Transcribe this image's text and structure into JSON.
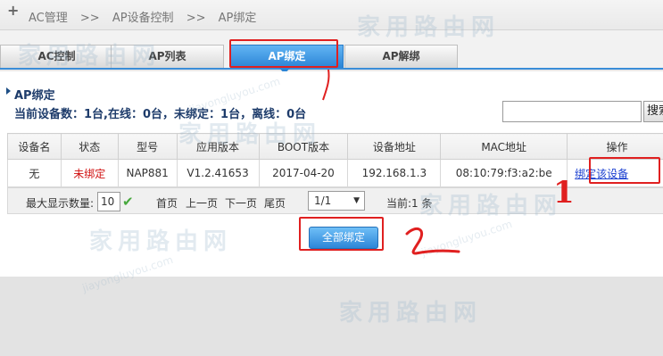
{
  "breadcrumb": {
    "items": [
      "AC管理",
      ">>",
      "AP设备控制",
      ">>",
      "AP绑定"
    ]
  },
  "tabs": [
    {
      "label": "AC控制"
    },
    {
      "label": "AP列表"
    },
    {
      "label": "AP绑定"
    },
    {
      "label": "AP解绑"
    }
  ],
  "active_tab": "AP绑定",
  "section": {
    "title": "AP绑定",
    "summary": "当前设备数：1台,在线：0台，未绑定：1台，离线：0台"
  },
  "search": {
    "value": "",
    "button_label": "搜索"
  },
  "table": {
    "headers": [
      "设备名",
      "状态",
      "型号",
      "应用版本",
      "BOOT版本",
      "设备地址",
      "MAC地址",
      "操作"
    ],
    "rows": [
      {
        "name": "无",
        "status": "未绑定",
        "model": "NAP881",
        "app_version": "V1.2.41653",
        "boot_version": "2017-04-20",
        "ip": "192.168.1.3",
        "mac": "08:10:79:f3:a2:be",
        "action": "绑定该设备"
      }
    ]
  },
  "pager": {
    "max_display_label": "最大显示数量:",
    "max_display_value": "10",
    "first": "首页",
    "prev": "上一页",
    "next": "下一页",
    "last": "尾页",
    "page_select": "1/1",
    "current": "当前:1 条"
  },
  "bind_all_label": "全部绑定",
  "annotations": {
    "mark_1": "1",
    "mark_2": "2"
  },
  "watermark": {
    "text": "家用路由网",
    "url": "jiayongluyou.com"
  },
  "colors": {
    "tab_active": "#2a84d6",
    "status_unbound": "#d01010",
    "annotation": "#e02020",
    "link": "#1a3fd0"
  }
}
